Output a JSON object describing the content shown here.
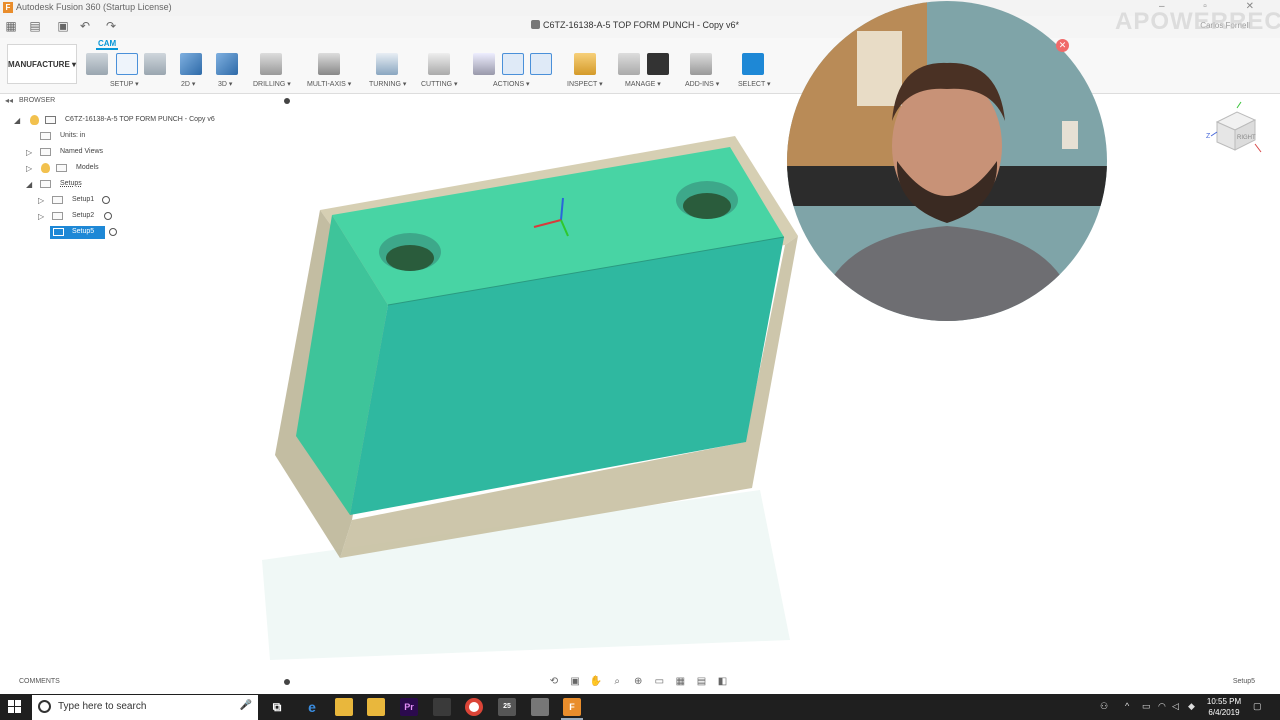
{
  "app": {
    "title": "Autodesk Fusion 360 (Startup License)",
    "logo": "F",
    "doc_title": "C6TZ-16138-A-5 TOP FORM PUNCH - Copy v6*",
    "account": "Carlos Fornell"
  },
  "ribbon": {
    "workspace": "MANUFACTURE ▾",
    "active_tab": "CAM",
    "groups": [
      {
        "label": "SETUP ▾"
      },
      {
        "label": "2D ▾"
      },
      {
        "label": "3D ▾"
      },
      {
        "label": "DRILLING ▾"
      },
      {
        "label": "MULTI-AXIS ▾"
      },
      {
        "label": "TURNING ▾"
      },
      {
        "label": "CUTTING ▾"
      },
      {
        "label": "ACTIONS ▾"
      },
      {
        "label": "INSPECT ▾"
      },
      {
        "label": "MANAGE ▾"
      },
      {
        "label": "ADD-INS ▾"
      },
      {
        "label": "SELECT ▾"
      }
    ]
  },
  "browser": {
    "title": "BROWSER",
    "root": "C6TZ-16138-A-5 TOP FORM PUNCH - Copy v6",
    "items": [
      {
        "label": "Units: in"
      },
      {
        "label": "Named Views"
      },
      {
        "label": "Models"
      },
      {
        "label": "Setups"
      },
      {
        "label": "Setup1"
      },
      {
        "label": "Setup2"
      },
      {
        "label": "Setup5"
      }
    ]
  },
  "comments": {
    "label": "COMMENTS"
  },
  "status": {
    "active_setup": "Setup5"
  },
  "watermark": "APOWERREC",
  "viewcube": {
    "face": "RIGHT"
  },
  "taskbar": {
    "search_placeholder": "Type here to search",
    "time": "10:55 PM",
    "date": "6/4/2019",
    "mail_badge": "25"
  },
  "colors": {
    "accent": "#0696d7",
    "model_top": "#48d4a4",
    "model_front": "#2fb8a0",
    "stock": "#c9c1a4"
  }
}
